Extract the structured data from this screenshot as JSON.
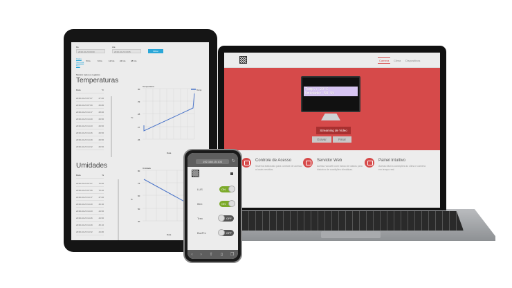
{
  "tablet": {
    "from_label": "De",
    "from_value": "2018-10-23 00:00",
    "to_label": "Até",
    "to_value": "2018-10-23 18:05",
    "filter_button": "Filtrar",
    "radio_links": [
      "Diaria",
      "Semana",
      "Mes"
    ],
    "radio_options": [
      "5 hrs",
      "6 hrs",
      "12 hrs",
      "24 hrs",
      "48 hrs"
    ],
    "show_all": "Mostrar todos os registros",
    "temp_title": "Temperaturas",
    "temp_headers": [
      "Data",
      "°C"
    ],
    "temp_rows": [
      [
        "2018-10-23 07:07",
        "27.00"
      ],
      [
        "2018-10-23 07:09",
        "26.80"
      ],
      [
        "2018-10-23 14:17",
        "28.60"
      ],
      [
        "2018-10-23 14:20",
        "29.50"
      ],
      [
        "2018-10-23 14:23",
        "29.50"
      ],
      [
        "2018-10-23 14:26",
        "29.50"
      ],
      [
        "2018-10-23 14:29",
        "29.50"
      ],
      [
        "2018-10-23 14:32",
        "29.50"
      ]
    ],
    "temp_chart": {
      "title": "Temperatura",
      "ylabel": "°C",
      "xlabel": "Data",
      "legend": "Temp",
      "yticks": [
        "30",
        "29",
        "28",
        "27",
        "26"
      ]
    },
    "hum_title": "Umidades",
    "hum_headers": [
      "Data",
      "%"
    ],
    "hum_rows": [
      [
        "2018-10-23 07:07",
        "70.00"
      ],
      [
        "2018-10-23 07:09",
        "70.40"
      ],
      [
        "2018-10-23 14:17",
        "47.00"
      ],
      [
        "2018-10-23 14:20",
        "46.30"
      ],
      [
        "2018-10-23 14:23",
        "44.50"
      ],
      [
        "2018-10-23 14:26",
        "44.50"
      ],
      [
        "2018-10-23 14:29",
        "45.10"
      ],
      [
        "2018-10-23 14:32",
        "44.80"
      ]
    ],
    "hum_chart": {
      "title": "Umidade",
      "ylabel": "%",
      "xlabel": "Data",
      "yticks": [
        "80",
        "75",
        "60",
        "50",
        "40"
      ]
    }
  },
  "laptop": {
    "nav": [
      "Camera",
      "Clima",
      "Dispositivos"
    ],
    "active_nav": "Camera",
    "lcd_line1": "Temp.: 29°C",
    "lcd_line2": "Umidade: 58.9%",
    "stream_button": "Streaming de Video",
    "record_button": "Gravar",
    "stop_button": "Parar",
    "features": [
      {
        "title": "Controle de Acesso",
        "desc": "Sistema elaborado para controle de acesso a locais restritos."
      },
      {
        "title": "Servidor Web",
        "desc": "Acesso via web com banco de dados para historico de condições climáticas."
      },
      {
        "title": "Painel Intuitivo",
        "desc": "Acesso fácil a condições do clima e camera em tempo real."
      }
    ],
    "colors": {
      "accent": "#d64a4a"
    }
  },
  "phone": {
    "url": "192.168.15.103",
    "devices": [
      {
        "label": "LUS",
        "state": "ON"
      },
      {
        "label": "Ilbrx",
        "state": "ON"
      },
      {
        "label": "Trex",
        "state": "OFF"
      },
      {
        "label": "BuzPrv",
        "state": "OFF"
      }
    ],
    "toolbar_icons": [
      "back-icon",
      "forward-icon",
      "share-icon",
      "bookmarks-icon",
      "tabs-icon"
    ]
  }
}
